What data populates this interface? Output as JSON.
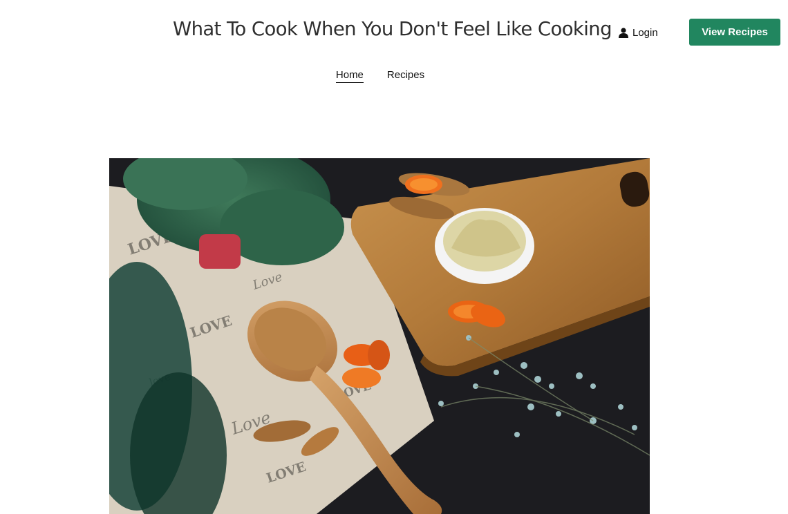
{
  "header": {
    "title": "What To Cook When You Don't Feel Like Cooking",
    "login_label": "Login",
    "cta_label": "View Recipes"
  },
  "nav": {
    "items": [
      {
        "label": "Home",
        "active": true
      },
      {
        "label": "Recipes",
        "active": false
      }
    ]
  },
  "hero": {
    "mat_text": [
      "LOVE",
      "Love",
      "love",
      "LOVE",
      "Love"
    ]
  },
  "colors": {
    "accent": "#21865f",
    "text": "#222222"
  }
}
